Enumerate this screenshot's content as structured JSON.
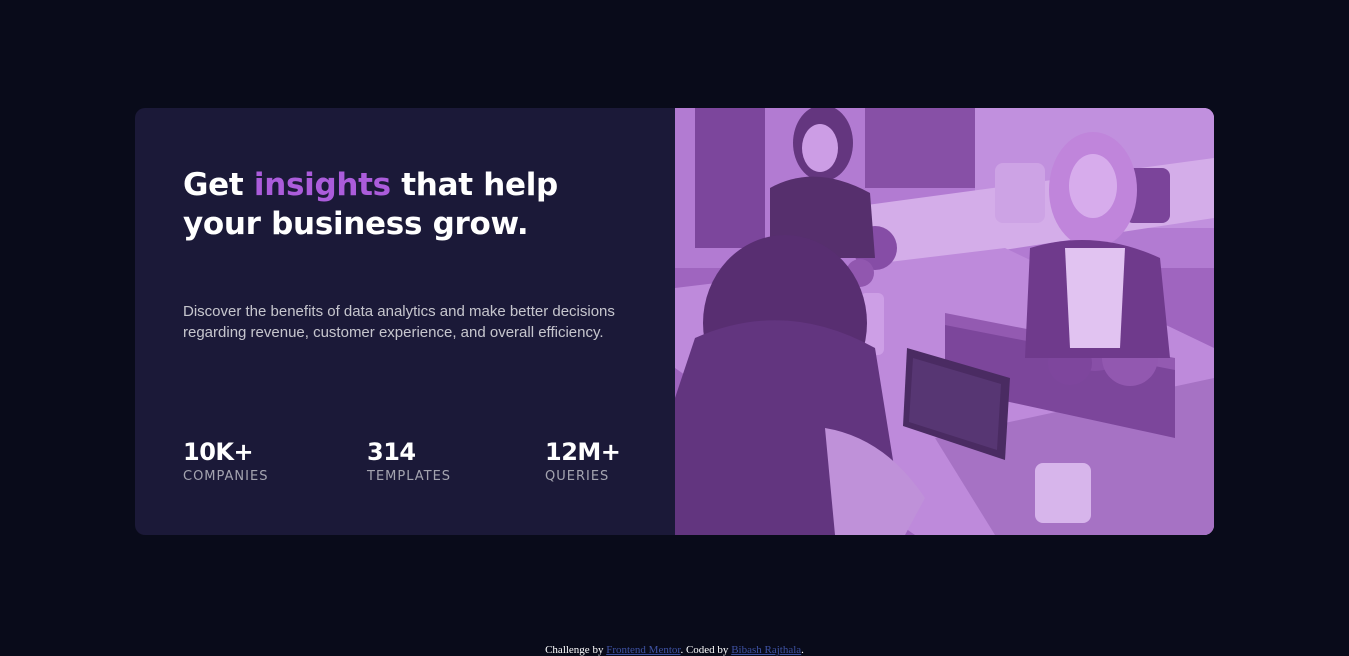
{
  "headline": {
    "before": "Get ",
    "accent": "insights",
    "after": " that help your business grow."
  },
  "description": "Discover the benefits of data analytics and make better decisions regarding revenue, customer experience, and overall efficiency.",
  "stats": [
    {
      "value": "10K+",
      "label": "COMPANIES"
    },
    {
      "value": "314",
      "label": "TEMPLATES"
    },
    {
      "value": "12M+",
      "label": "QUERIES"
    }
  ],
  "image": {
    "description": "three women working at a table with laptops",
    "overlay_color": "#aa5cdb"
  },
  "footer": {
    "prefix": "Challenge by ",
    "link1": "Frontend Mentor",
    "middle": ". Coded by ",
    "link2": "Bibash Rajthala",
    "suffix": "."
  },
  "colors": {
    "page_bg": "#090b1a",
    "card_bg": "#1b1938",
    "accent": "#ab5cdb",
    "link": "#3e52a3"
  }
}
